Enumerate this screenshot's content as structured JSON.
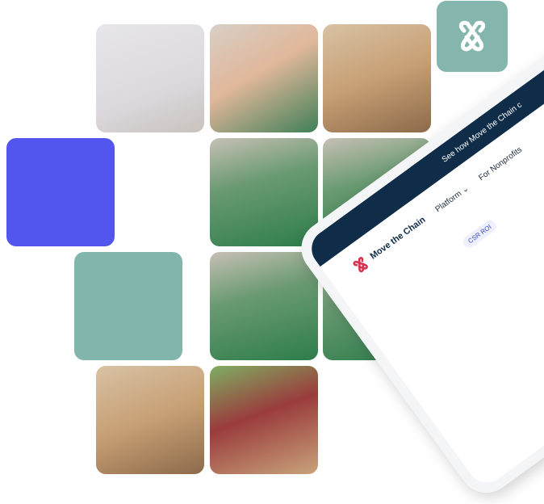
{
  "brand": {
    "name": "Move the Chain",
    "accent": "#d6334f",
    "logo_tile_color": "#84b6ad"
  },
  "tiles": {
    "blue": "#5356ee",
    "teal": "#82b6ad"
  },
  "tablet": {
    "banner_text": "See how Move the Chain c",
    "nav_items": [
      "Platform",
      "For Nonprofits"
    ],
    "platform_chevron_icon": "chevron-down-icon",
    "chips": [
      "CSR ROI"
    ]
  }
}
